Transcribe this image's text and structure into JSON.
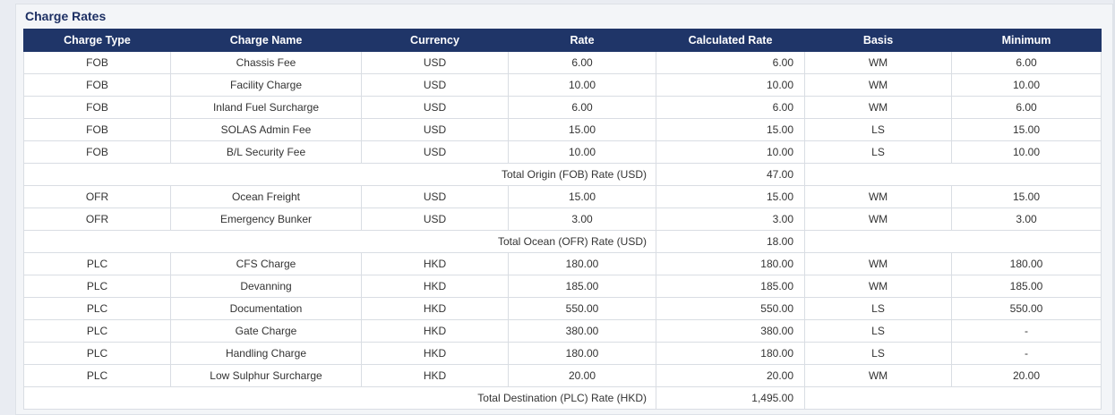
{
  "section_title": "Charge Rates",
  "columns": [
    "Charge Type",
    "Charge Name",
    "Currency",
    "Rate",
    "Calculated Rate",
    "Basis",
    "Minimum"
  ],
  "groups": [
    {
      "rows": [
        {
          "type": "FOB",
          "name": "Chassis Fee",
          "currency": "USD",
          "rate": "6.00",
          "calc": "6.00",
          "basis": "WM",
          "min": "6.00"
        },
        {
          "type": "FOB",
          "name": "Facility Charge",
          "currency": "USD",
          "rate": "10.00",
          "calc": "10.00",
          "basis": "WM",
          "min": "10.00"
        },
        {
          "type": "FOB",
          "name": "Inland Fuel Surcharge",
          "currency": "USD",
          "rate": "6.00",
          "calc": "6.00",
          "basis": "WM",
          "min": "6.00"
        },
        {
          "type": "FOB",
          "name": "SOLAS Admin Fee",
          "currency": "USD",
          "rate": "15.00",
          "calc": "15.00",
          "basis": "LS",
          "min": "15.00"
        },
        {
          "type": "FOB",
          "name": "B/L Security Fee",
          "currency": "USD",
          "rate": "10.00",
          "calc": "10.00",
          "basis": "LS",
          "min": "10.00"
        }
      ],
      "total_label": "Total Origin (FOB) Rate (USD)",
      "total_value": "47.00"
    },
    {
      "rows": [
        {
          "type": "OFR",
          "name": "Ocean Freight",
          "currency": "USD",
          "rate": "15.00",
          "calc": "15.00",
          "basis": "WM",
          "min": "15.00"
        },
        {
          "type": "OFR",
          "name": "Emergency Bunker",
          "currency": "USD",
          "rate": "3.00",
          "calc": "3.00",
          "basis": "WM",
          "min": "3.00"
        }
      ],
      "total_label": "Total Ocean (OFR) Rate (USD)",
      "total_value": "18.00"
    },
    {
      "rows": [
        {
          "type": "PLC",
          "name": "CFS Charge",
          "currency": "HKD",
          "rate": "180.00",
          "calc": "180.00",
          "basis": "WM",
          "min": "180.00"
        },
        {
          "type": "PLC",
          "name": "Devanning",
          "currency": "HKD",
          "rate": "185.00",
          "calc": "185.00",
          "basis": "WM",
          "min": "185.00"
        },
        {
          "type": "PLC",
          "name": "Documentation",
          "currency": "HKD",
          "rate": "550.00",
          "calc": "550.00",
          "basis": "LS",
          "min": "550.00"
        },
        {
          "type": "PLC",
          "name": "Gate Charge",
          "currency": "HKD",
          "rate": "380.00",
          "calc": "380.00",
          "basis": "LS",
          "min": "-"
        },
        {
          "type": "PLC",
          "name": "Handling Charge",
          "currency": "HKD",
          "rate": "180.00",
          "calc": "180.00",
          "basis": "LS",
          "min": "-"
        },
        {
          "type": "PLC",
          "name": "Low Sulphur Surcharge",
          "currency": "HKD",
          "rate": "20.00",
          "calc": "20.00",
          "basis": "WM",
          "min": "20.00"
        }
      ],
      "total_label": "Total Destination (PLC) Rate (HKD)",
      "total_value": "1,495.00"
    }
  ]
}
